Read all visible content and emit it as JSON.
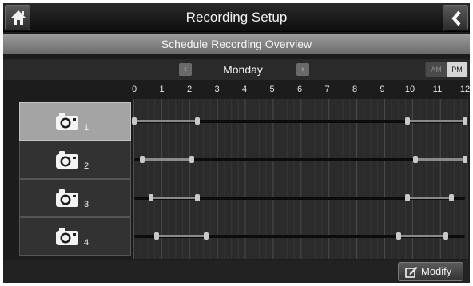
{
  "header": {
    "title": "Recording Setup",
    "home_icon": "home-icon",
    "back_icon": "chevron-left-icon"
  },
  "overview_title": "Schedule Recording Overview",
  "day_nav": {
    "day": "Monday",
    "prev_glyph": "‹",
    "next_glyph": "›",
    "am_label": "AM",
    "pm_label": "PM",
    "selected_period": "PM"
  },
  "hours": [
    "0",
    "1",
    "2",
    "3",
    "4",
    "5",
    "6",
    "7",
    "8",
    "9",
    "10",
    "11",
    "12"
  ],
  "cameras": [
    {
      "number": "1",
      "icon": "camera-icon",
      "selected": true,
      "schedule": [
        {
          "start": 0.0,
          "end": 2.3
        },
        {
          "start": 9.9,
          "end": 12.0
        }
      ]
    },
    {
      "number": "2",
      "icon": "camera-icon",
      "selected": false,
      "schedule": [
        {
          "start": 0.3,
          "end": 2.1
        },
        {
          "start": 10.2,
          "end": 12.0
        }
      ]
    },
    {
      "number": "3",
      "icon": "camera-icon",
      "selected": false,
      "schedule": [
        {
          "start": 0.6,
          "end": 2.3
        },
        {
          "start": 9.9,
          "end": 11.5
        }
      ]
    },
    {
      "number": "4",
      "icon": "camera-icon",
      "selected": false,
      "schedule": [
        {
          "start": 0.8,
          "end": 2.6
        },
        {
          "start": 9.6,
          "end": 11.3
        }
      ]
    }
  ],
  "modify_button": {
    "label": "Modify",
    "icon": "edit-icon"
  },
  "colors": {
    "selected_cell": "#a4a4a4",
    "schedule_segment": "#8a8a8a",
    "handle": "#c9c9c9"
  }
}
